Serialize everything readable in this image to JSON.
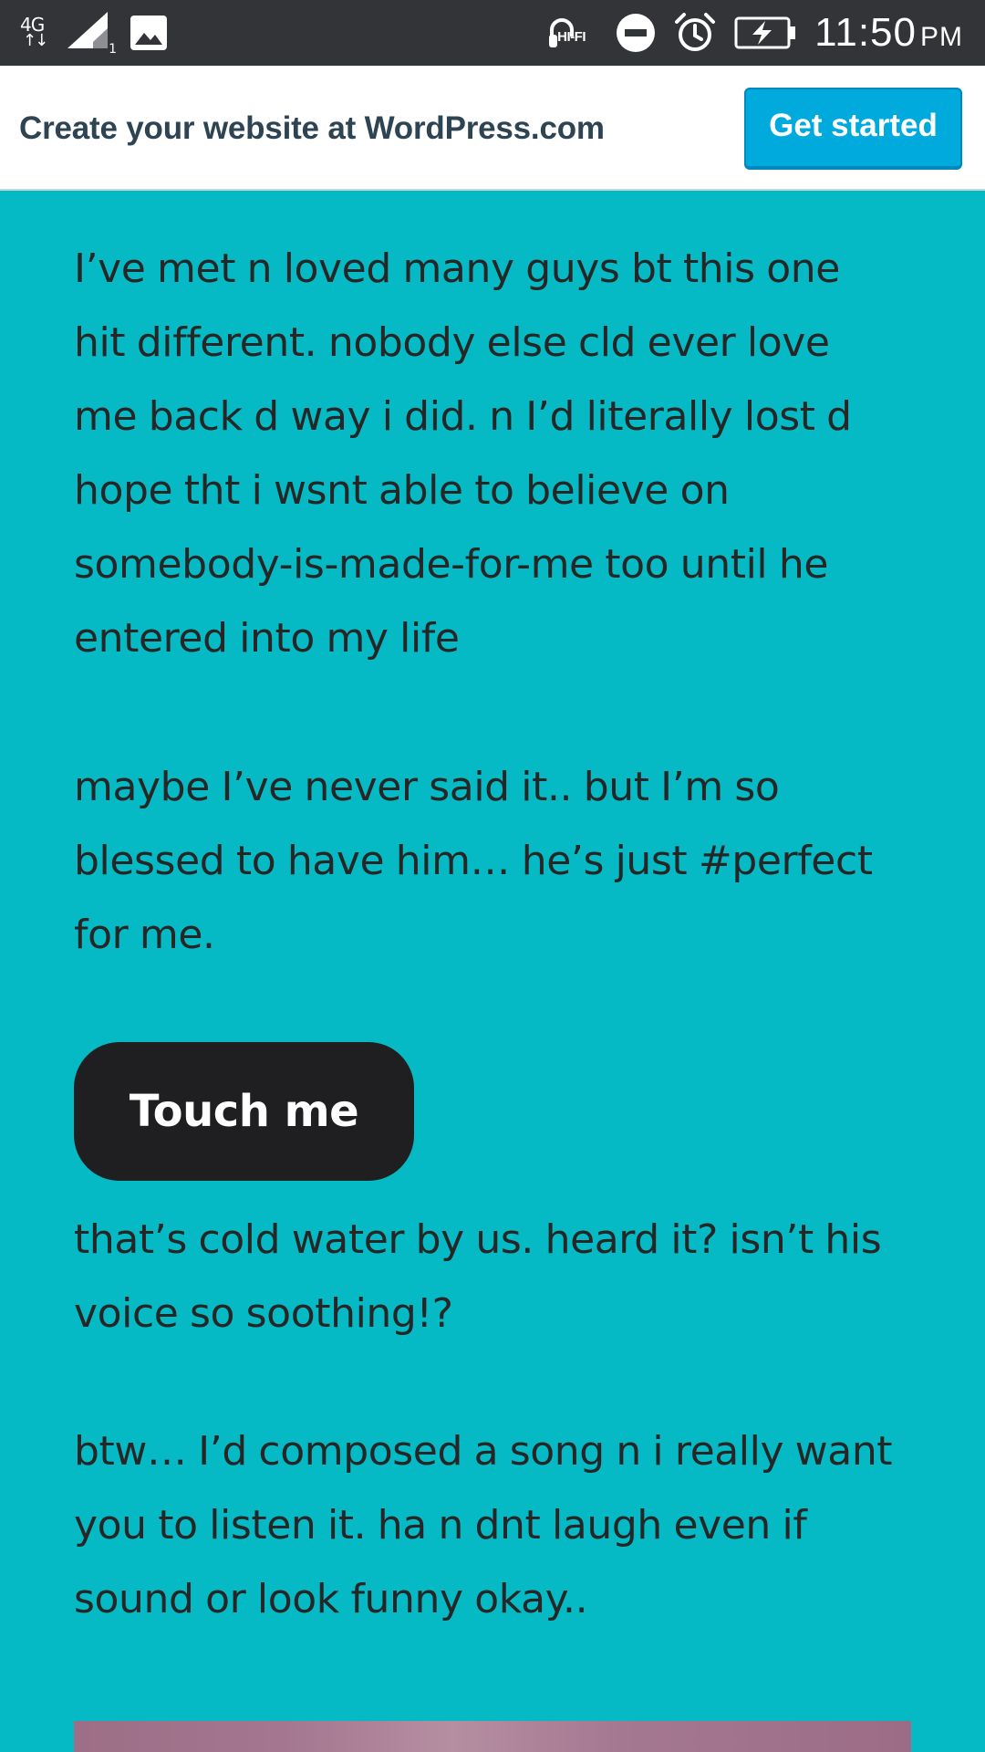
{
  "status_bar": {
    "network_type": "4G",
    "sim_slot": "1",
    "hifi_label": "HI-FI",
    "time": "11:50",
    "ampm": "PM",
    "icons": [
      "4g-data-icon",
      "signal-strength-icon",
      "gallery-notification-icon",
      "hifi-headphones-icon",
      "do-not-disturb-icon",
      "alarm-icon",
      "battery-charging-icon"
    ]
  },
  "wp_banner": {
    "text": "Create your website at WordPress.com",
    "button_label": "Get started",
    "colors": {
      "button": "#00aadc",
      "text": "#2e4453"
    }
  },
  "post": {
    "paragraph_1": "I’ve met n loved many guys bt this one\nhit different. nobody else cld ever love\nme back d way i did. n I’d literally lost d\nhope tht i wsnt able to believe on\nsomebody-is-made-for-me too until he\nentered into my life",
    "paragraph_2": "maybe I’ve never said it.. but I’m so\nblessed to have him… he’s just #perfect\nfor me.",
    "button_label": "Touch me",
    "paragraph_3": "that’s cold water by us. heard it? isn’t his\nvoice so soothing!?",
    "paragraph_4": "btw… I’d composed a song n i really want\nyou to listen it. ha n dnt laugh even if\nsound or look funny okay..",
    "colors": {
      "background": "#05bac4",
      "text": "#262626",
      "button": "#1f1f21"
    }
  }
}
